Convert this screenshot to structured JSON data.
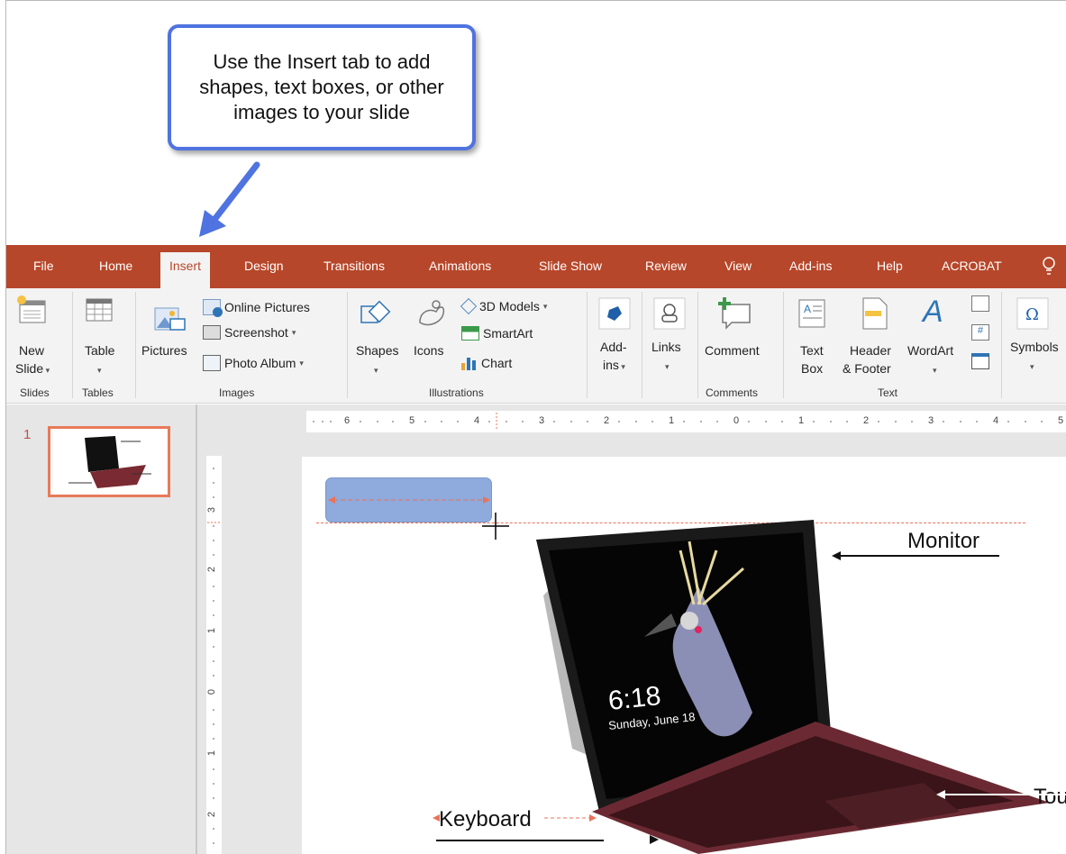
{
  "callout": {
    "text": "Use the Insert tab to add shapes, text boxes, or other images to your slide"
  },
  "tabs": [
    "File",
    "Home",
    "Insert",
    "Design",
    "Transitions",
    "Animations",
    "Slide Show",
    "Review",
    "View",
    "Add-ins",
    "Help",
    "ACROBAT"
  ],
  "active_tab": "Insert",
  "ribbon": {
    "slides": {
      "new_slide_1": "New",
      "new_slide_2": "Slide",
      "group": "Slides"
    },
    "tables": {
      "table": "Table",
      "group": "Tables"
    },
    "images": {
      "pictures": "Pictures",
      "online_pictures": "Online Pictures",
      "screenshot": "Screenshot",
      "photo_album": "Photo Album",
      "group": "Images"
    },
    "illustrations": {
      "shapes": "Shapes",
      "icons": "Icons",
      "models_3d": "3D Models",
      "smartart": "SmartArt",
      "chart": "Chart",
      "group": "Illustrations"
    },
    "addins": {
      "addins_1": "Add-",
      "addins_2": "ins"
    },
    "links": {
      "links": "Links"
    },
    "comments": {
      "comment": "Comment",
      "group": "Comments"
    },
    "text": {
      "textbox_1": "Text",
      "textbox_2": "Box",
      "header_1": "Header",
      "header_2": "& Footer",
      "wordart": "WordArt",
      "group": "Text"
    },
    "symbols": {
      "symbols": "Symbols"
    }
  },
  "thumbnail": {
    "number": "1"
  },
  "hruler": [
    "6",
    "5",
    "4",
    "3",
    "2",
    "1",
    "0",
    "1",
    "2",
    "3",
    "4",
    "5"
  ],
  "vruler": [
    "3",
    "2",
    "1",
    "0",
    "1",
    "2"
  ],
  "slide": {
    "screen_time": "6:18",
    "screen_date": "Sunday, June 18",
    "label_monitor": "Monitor",
    "label_keyboard": "Keyboard",
    "label_touchpad": "Tou"
  },
  "colors": {
    "ribbon_accent": "#b7472a",
    "callout_border": "#4f73e0",
    "guide": "#e8735a",
    "shape_fill": "#8faadc"
  },
  "icons": {
    "tell_me": "lightbulb-icon"
  }
}
